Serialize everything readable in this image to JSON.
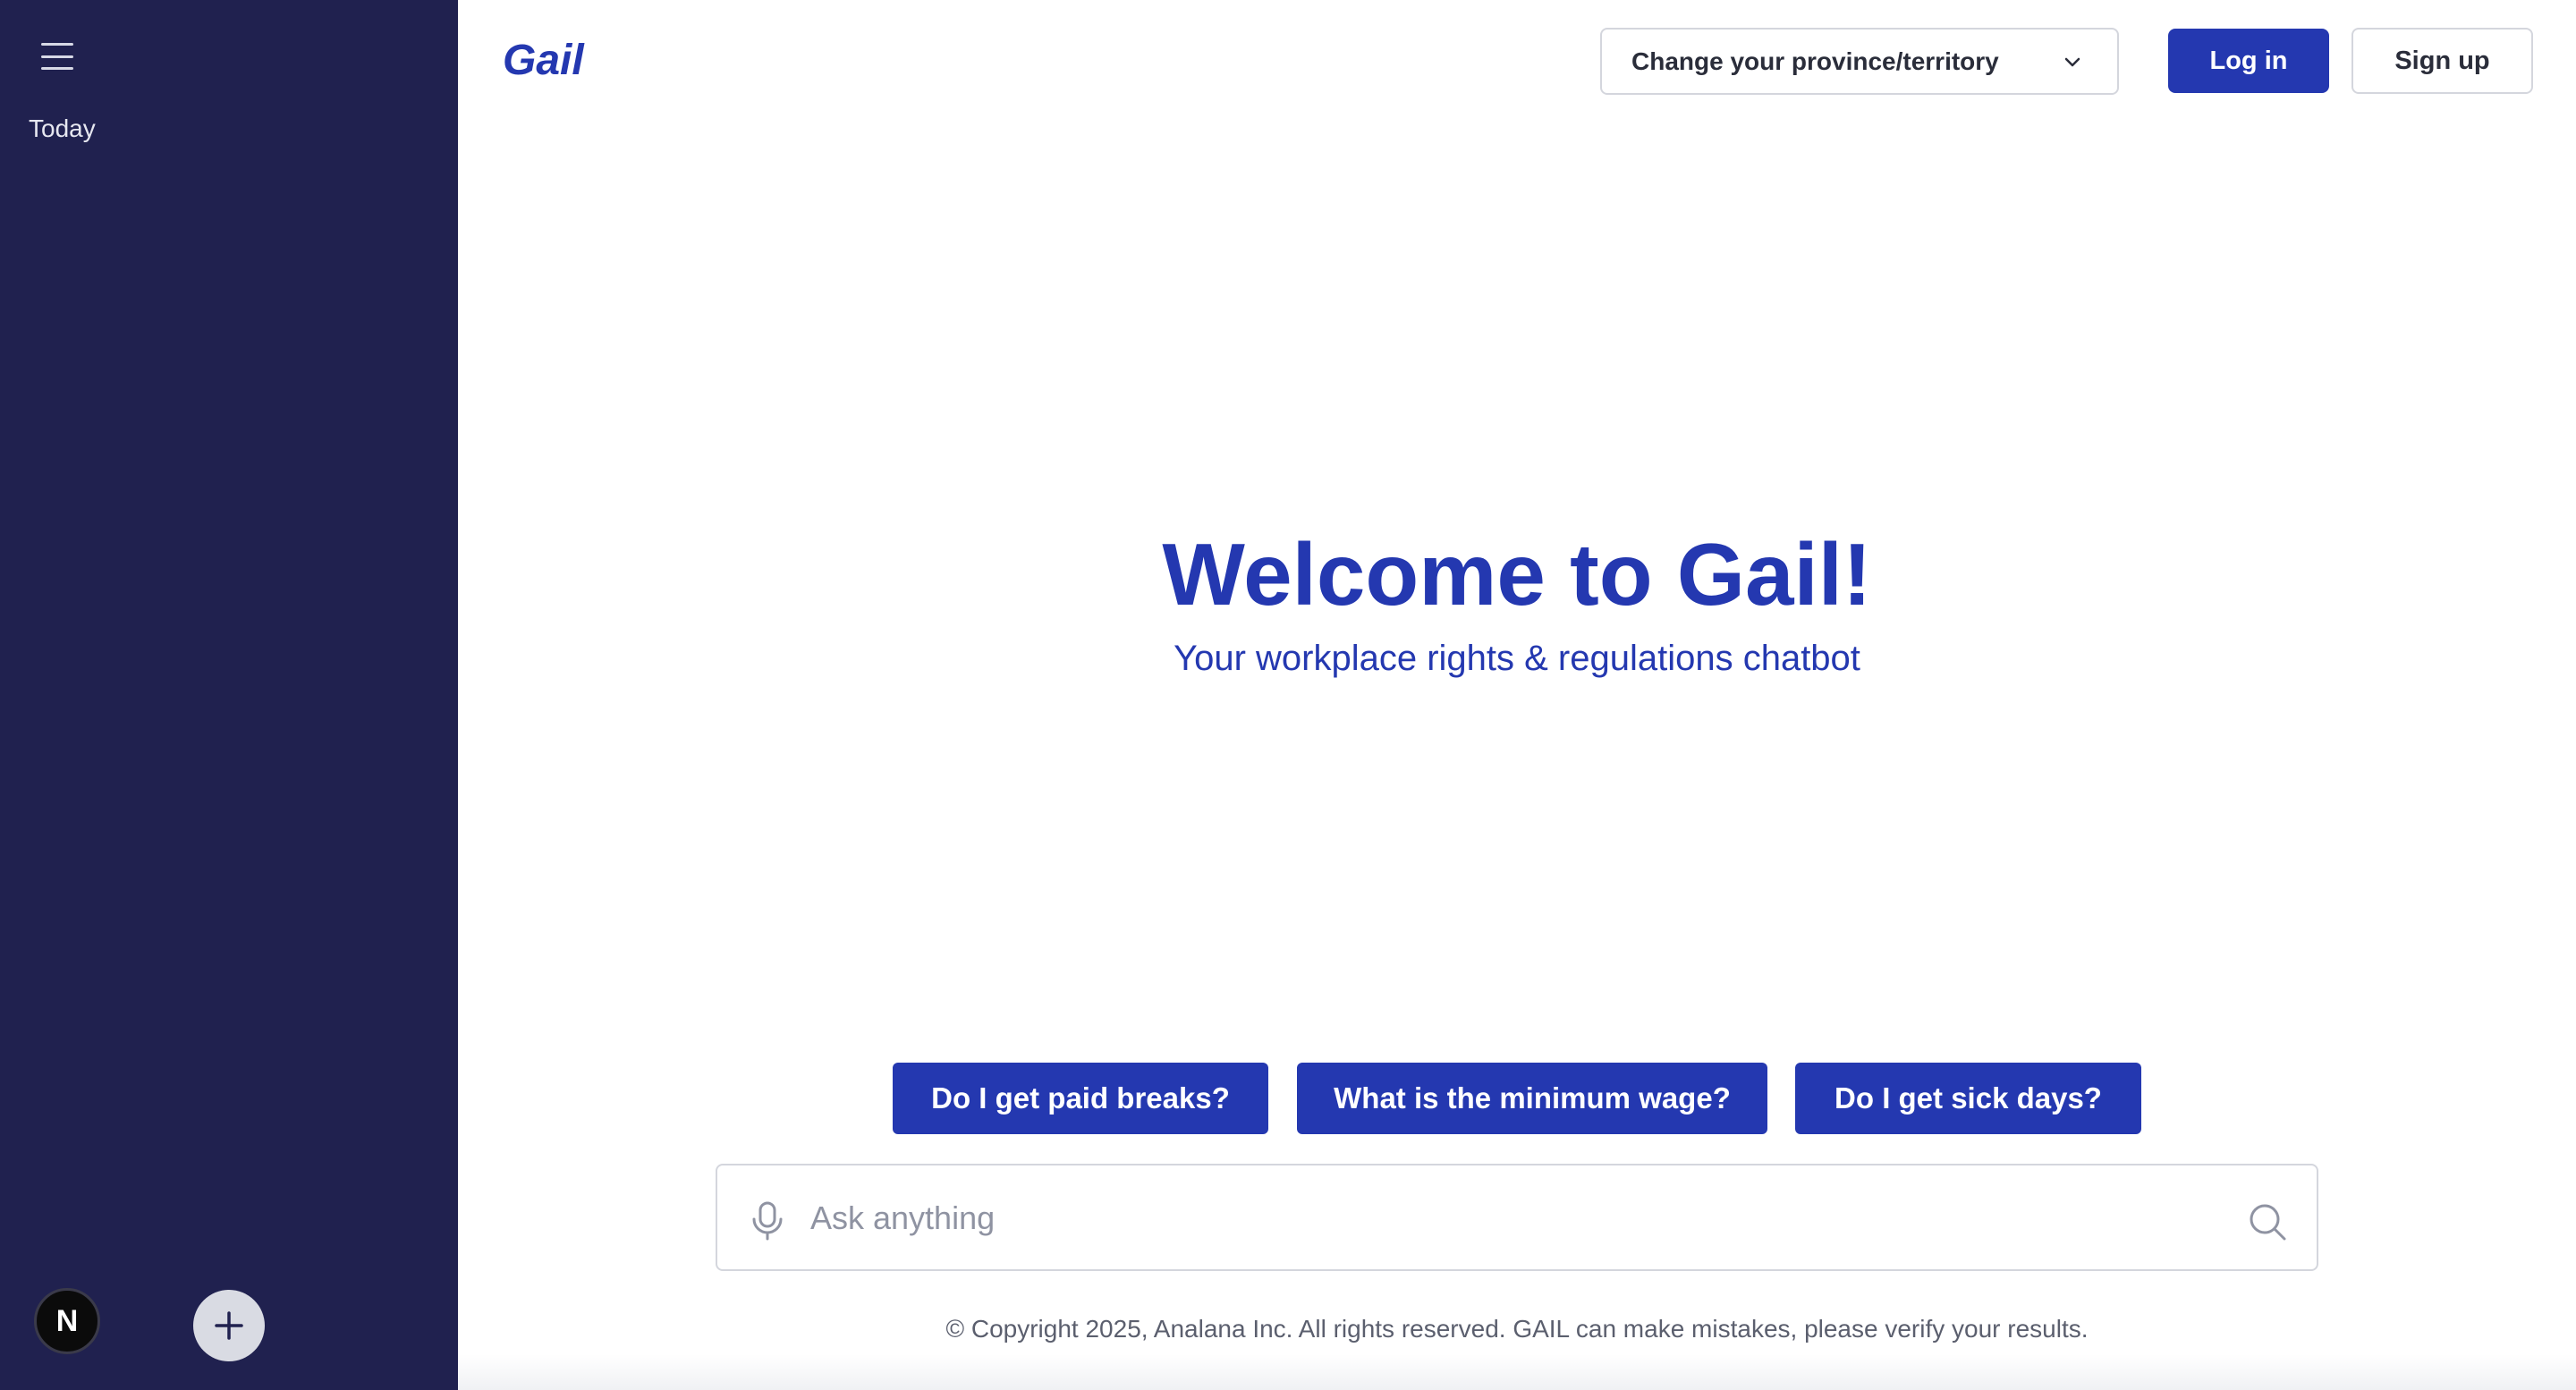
{
  "sidebar": {
    "menu_icon": "hamburger-menu-icon",
    "section_label": "Today",
    "badge_letter": "N",
    "new_chat_icon": "plus-icon",
    "background_color": "#20214f"
  },
  "header": {
    "brand": "Gail",
    "province_select": {
      "label": "Change your province/territory",
      "icon": "chevron-down-icon"
    },
    "login_label": "Log in",
    "signup_label": "Sign up"
  },
  "hero": {
    "title": "Welcome to Gail!",
    "subtitle": "Your workplace rights & regulations chatbot"
  },
  "suggestions": [
    "Do I get paid breaks?",
    "What is the minimum wage?",
    "Do I get sick days?"
  ],
  "search": {
    "placeholder": "Ask anything",
    "value": "",
    "mic_icon": "microphone-icon",
    "search_icon": "search-icon"
  },
  "footer": {
    "text": "© Copyright 2025, Analana Inc. All rights reserved. GAIL can make mistakes, please verify your results."
  },
  "colors": {
    "accent": "#2438b0",
    "sidebar": "#20214f",
    "border": "#d4d6dd"
  }
}
